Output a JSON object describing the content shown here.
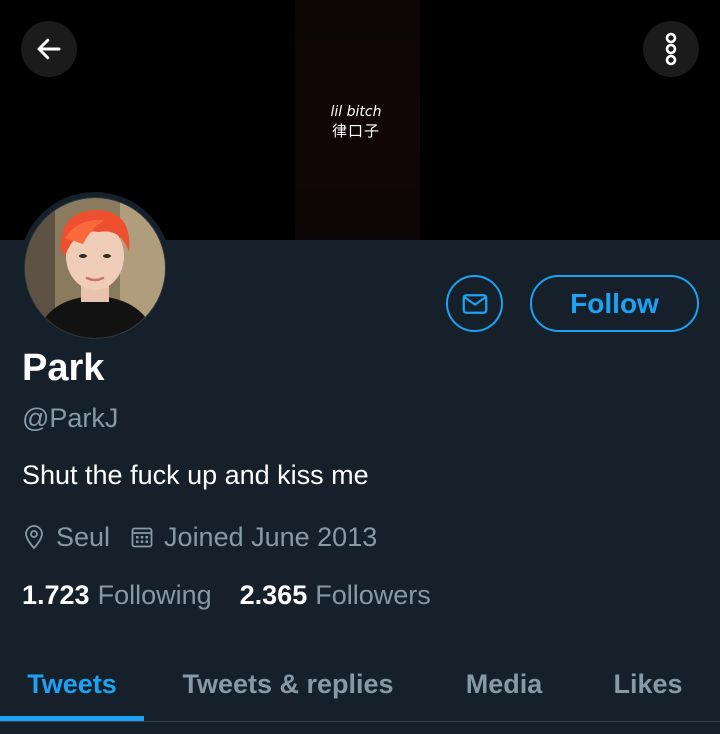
{
  "header": {
    "banner_line1": "lil bitch",
    "banner_line2": "律口子",
    "back_icon": "arrow-left-icon",
    "more_icon": "more-vertical-icon"
  },
  "profile": {
    "name": "Park",
    "handle": "@ParkJ",
    "bio": "Shut the fuck up and kiss me",
    "location": "Seul",
    "joined": "Joined June 2013",
    "following_count": "1.723",
    "following_label": "Following",
    "followers_count": "2.365",
    "followers_label": "Followers"
  },
  "actions": {
    "message_icon": "mail-icon",
    "follow_label": "Follow"
  },
  "tabs": [
    {
      "label": "Tweets",
      "active": true
    },
    {
      "label": "Tweets & replies",
      "active": false
    },
    {
      "label": "Media",
      "active": false
    },
    {
      "label": "Likes",
      "active": false
    }
  ],
  "colors": {
    "background": "#15202b",
    "accent": "#1da1f2",
    "secondary_text": "#8899a6"
  }
}
